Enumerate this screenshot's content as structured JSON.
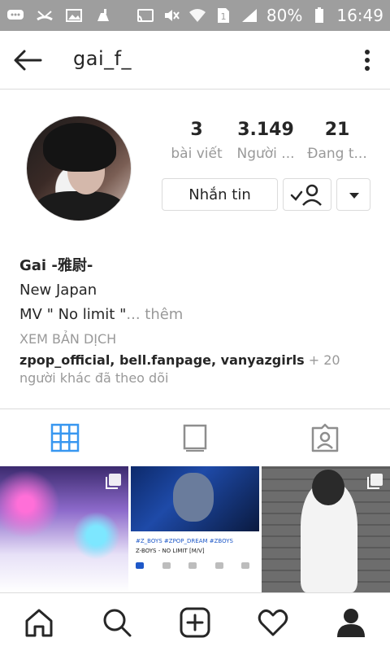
{
  "status_bar": {
    "battery_percent": "80%",
    "time": "16:49",
    "sim_slot": "1",
    "icons": [
      "chat-bubble-icon",
      "missed-call-icon",
      "image-icon",
      "cleaner-icon",
      "cast-icon",
      "mute-icon",
      "wifi-icon",
      "sim-icon",
      "signal-icon",
      "battery-icon"
    ]
  },
  "header": {
    "username": "gai_f_",
    "back_icon": "arrow-left-icon",
    "menu_icon": "more-vertical-icon"
  },
  "profile": {
    "stats": [
      {
        "value": "3",
        "label": "bài viết"
      },
      {
        "value": "3.149",
        "label": "Người ..."
      },
      {
        "value": "21",
        "label": "Đang t..."
      }
    ],
    "message_button": "Nhắn tin",
    "bio": {
      "name": "Gai -雅尉-",
      "line1": "New    Japan",
      "line2": "MV \" No limit \"",
      "more": "... thêm",
      "translate": "XEM BẢN DỊCH"
    },
    "followed_by": {
      "names": "zpop_official, bell.fanpage, vanyazgirls",
      "suffix": " + 20 người khác đã theo dõi"
    }
  },
  "tabs": [
    "grid-icon",
    "feed-icon",
    "tagged-icon"
  ],
  "active_tab": "grid",
  "posts": [
    {
      "type": "photo",
      "multi": true
    },
    {
      "type": "screenshot",
      "tags": "#Z_BOYS #ZPOP_DREAM #ZBOYS",
      "title": "Z-BOYS - NO LIMIT [M/V]"
    },
    {
      "type": "photo",
      "multi": true
    }
  ],
  "bottom_nav": [
    "home-icon",
    "search-icon",
    "add-post-icon",
    "activity-heart-icon",
    "profile-icon"
  ],
  "colors": {
    "accent_blue": "#3897f0",
    "text": "#262626",
    "secondary_text": "#999999",
    "border": "#dbdbdb",
    "status_bar": "#9e9e9e"
  }
}
